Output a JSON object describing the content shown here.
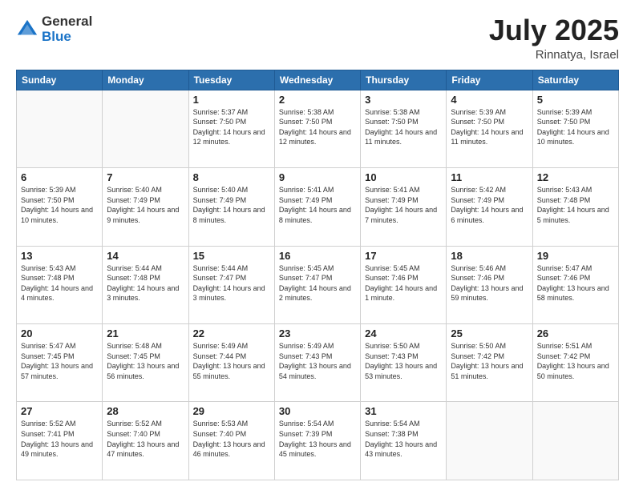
{
  "header": {
    "logo_general": "General",
    "logo_blue": "Blue",
    "title_month": "July 2025",
    "title_location": "Rinnatya, Israel"
  },
  "weekdays": [
    "Sunday",
    "Monday",
    "Tuesday",
    "Wednesday",
    "Thursday",
    "Friday",
    "Saturday"
  ],
  "weeks": [
    [
      {
        "day": "",
        "sunrise": "",
        "sunset": "",
        "daylight": ""
      },
      {
        "day": "",
        "sunrise": "",
        "sunset": "",
        "daylight": ""
      },
      {
        "day": "1",
        "sunrise": "Sunrise: 5:37 AM",
        "sunset": "Sunset: 7:50 PM",
        "daylight": "Daylight: 14 hours and 12 minutes."
      },
      {
        "day": "2",
        "sunrise": "Sunrise: 5:38 AM",
        "sunset": "Sunset: 7:50 PM",
        "daylight": "Daylight: 14 hours and 12 minutes."
      },
      {
        "day": "3",
        "sunrise": "Sunrise: 5:38 AM",
        "sunset": "Sunset: 7:50 PM",
        "daylight": "Daylight: 14 hours and 11 minutes."
      },
      {
        "day": "4",
        "sunrise": "Sunrise: 5:39 AM",
        "sunset": "Sunset: 7:50 PM",
        "daylight": "Daylight: 14 hours and 11 minutes."
      },
      {
        "day": "5",
        "sunrise": "Sunrise: 5:39 AM",
        "sunset": "Sunset: 7:50 PM",
        "daylight": "Daylight: 14 hours and 10 minutes."
      }
    ],
    [
      {
        "day": "6",
        "sunrise": "Sunrise: 5:39 AM",
        "sunset": "Sunset: 7:50 PM",
        "daylight": "Daylight: 14 hours and 10 minutes."
      },
      {
        "day": "7",
        "sunrise": "Sunrise: 5:40 AM",
        "sunset": "Sunset: 7:49 PM",
        "daylight": "Daylight: 14 hours and 9 minutes."
      },
      {
        "day": "8",
        "sunrise": "Sunrise: 5:40 AM",
        "sunset": "Sunset: 7:49 PM",
        "daylight": "Daylight: 14 hours and 8 minutes."
      },
      {
        "day": "9",
        "sunrise": "Sunrise: 5:41 AM",
        "sunset": "Sunset: 7:49 PM",
        "daylight": "Daylight: 14 hours and 8 minutes."
      },
      {
        "day": "10",
        "sunrise": "Sunrise: 5:41 AM",
        "sunset": "Sunset: 7:49 PM",
        "daylight": "Daylight: 14 hours and 7 minutes."
      },
      {
        "day": "11",
        "sunrise": "Sunrise: 5:42 AM",
        "sunset": "Sunset: 7:49 PM",
        "daylight": "Daylight: 14 hours and 6 minutes."
      },
      {
        "day": "12",
        "sunrise": "Sunrise: 5:43 AM",
        "sunset": "Sunset: 7:48 PM",
        "daylight": "Daylight: 14 hours and 5 minutes."
      }
    ],
    [
      {
        "day": "13",
        "sunrise": "Sunrise: 5:43 AM",
        "sunset": "Sunset: 7:48 PM",
        "daylight": "Daylight: 14 hours and 4 minutes."
      },
      {
        "day": "14",
        "sunrise": "Sunrise: 5:44 AM",
        "sunset": "Sunset: 7:48 PM",
        "daylight": "Daylight: 14 hours and 3 minutes."
      },
      {
        "day": "15",
        "sunrise": "Sunrise: 5:44 AM",
        "sunset": "Sunset: 7:47 PM",
        "daylight": "Daylight: 14 hours and 3 minutes."
      },
      {
        "day": "16",
        "sunrise": "Sunrise: 5:45 AM",
        "sunset": "Sunset: 7:47 PM",
        "daylight": "Daylight: 14 hours and 2 minutes."
      },
      {
        "day": "17",
        "sunrise": "Sunrise: 5:45 AM",
        "sunset": "Sunset: 7:46 PM",
        "daylight": "Daylight: 14 hours and 1 minute."
      },
      {
        "day": "18",
        "sunrise": "Sunrise: 5:46 AM",
        "sunset": "Sunset: 7:46 PM",
        "daylight": "Daylight: 13 hours and 59 minutes."
      },
      {
        "day": "19",
        "sunrise": "Sunrise: 5:47 AM",
        "sunset": "Sunset: 7:46 PM",
        "daylight": "Daylight: 13 hours and 58 minutes."
      }
    ],
    [
      {
        "day": "20",
        "sunrise": "Sunrise: 5:47 AM",
        "sunset": "Sunset: 7:45 PM",
        "daylight": "Daylight: 13 hours and 57 minutes."
      },
      {
        "day": "21",
        "sunrise": "Sunrise: 5:48 AM",
        "sunset": "Sunset: 7:45 PM",
        "daylight": "Daylight: 13 hours and 56 minutes."
      },
      {
        "day": "22",
        "sunrise": "Sunrise: 5:49 AM",
        "sunset": "Sunset: 7:44 PM",
        "daylight": "Daylight: 13 hours and 55 minutes."
      },
      {
        "day": "23",
        "sunrise": "Sunrise: 5:49 AM",
        "sunset": "Sunset: 7:43 PM",
        "daylight": "Daylight: 13 hours and 54 minutes."
      },
      {
        "day": "24",
        "sunrise": "Sunrise: 5:50 AM",
        "sunset": "Sunset: 7:43 PM",
        "daylight": "Daylight: 13 hours and 53 minutes."
      },
      {
        "day": "25",
        "sunrise": "Sunrise: 5:50 AM",
        "sunset": "Sunset: 7:42 PM",
        "daylight": "Daylight: 13 hours and 51 minutes."
      },
      {
        "day": "26",
        "sunrise": "Sunrise: 5:51 AM",
        "sunset": "Sunset: 7:42 PM",
        "daylight": "Daylight: 13 hours and 50 minutes."
      }
    ],
    [
      {
        "day": "27",
        "sunrise": "Sunrise: 5:52 AM",
        "sunset": "Sunset: 7:41 PM",
        "daylight": "Daylight: 13 hours and 49 minutes."
      },
      {
        "day": "28",
        "sunrise": "Sunrise: 5:52 AM",
        "sunset": "Sunset: 7:40 PM",
        "daylight": "Daylight: 13 hours and 47 minutes."
      },
      {
        "day": "29",
        "sunrise": "Sunrise: 5:53 AM",
        "sunset": "Sunset: 7:40 PM",
        "daylight": "Daylight: 13 hours and 46 minutes."
      },
      {
        "day": "30",
        "sunrise": "Sunrise: 5:54 AM",
        "sunset": "Sunset: 7:39 PM",
        "daylight": "Daylight: 13 hours and 45 minutes."
      },
      {
        "day": "31",
        "sunrise": "Sunrise: 5:54 AM",
        "sunset": "Sunset: 7:38 PM",
        "daylight": "Daylight: 13 hours and 43 minutes."
      },
      {
        "day": "",
        "sunrise": "",
        "sunset": "",
        "daylight": ""
      },
      {
        "day": "",
        "sunrise": "",
        "sunset": "",
        "daylight": ""
      }
    ]
  ]
}
